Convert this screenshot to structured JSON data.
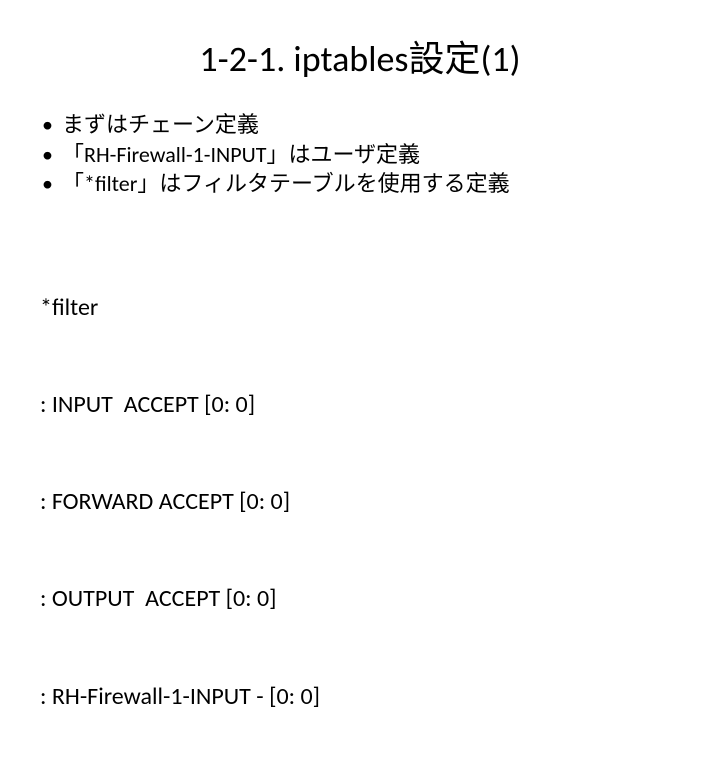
{
  "title": "1-2-1. iptables設定(1)",
  "bullets": [
    "まずはチェーン定義",
    "「RH-Firewall-1-INPUT」はユーザ定義",
    "「*filter」はフィルタテーブルを使用する定義"
  ],
  "code": {
    "l0": "*filter",
    "l1": ": INPUT  ACCEPT [0: 0]",
    "l2": ": FORWARD ACCEPT [0: 0]",
    "l3": ": OUTPUT  ACCEPT [0: 0]",
    "l4": ": RH-Firewall-1-INPUT - [0: 0]"
  }
}
